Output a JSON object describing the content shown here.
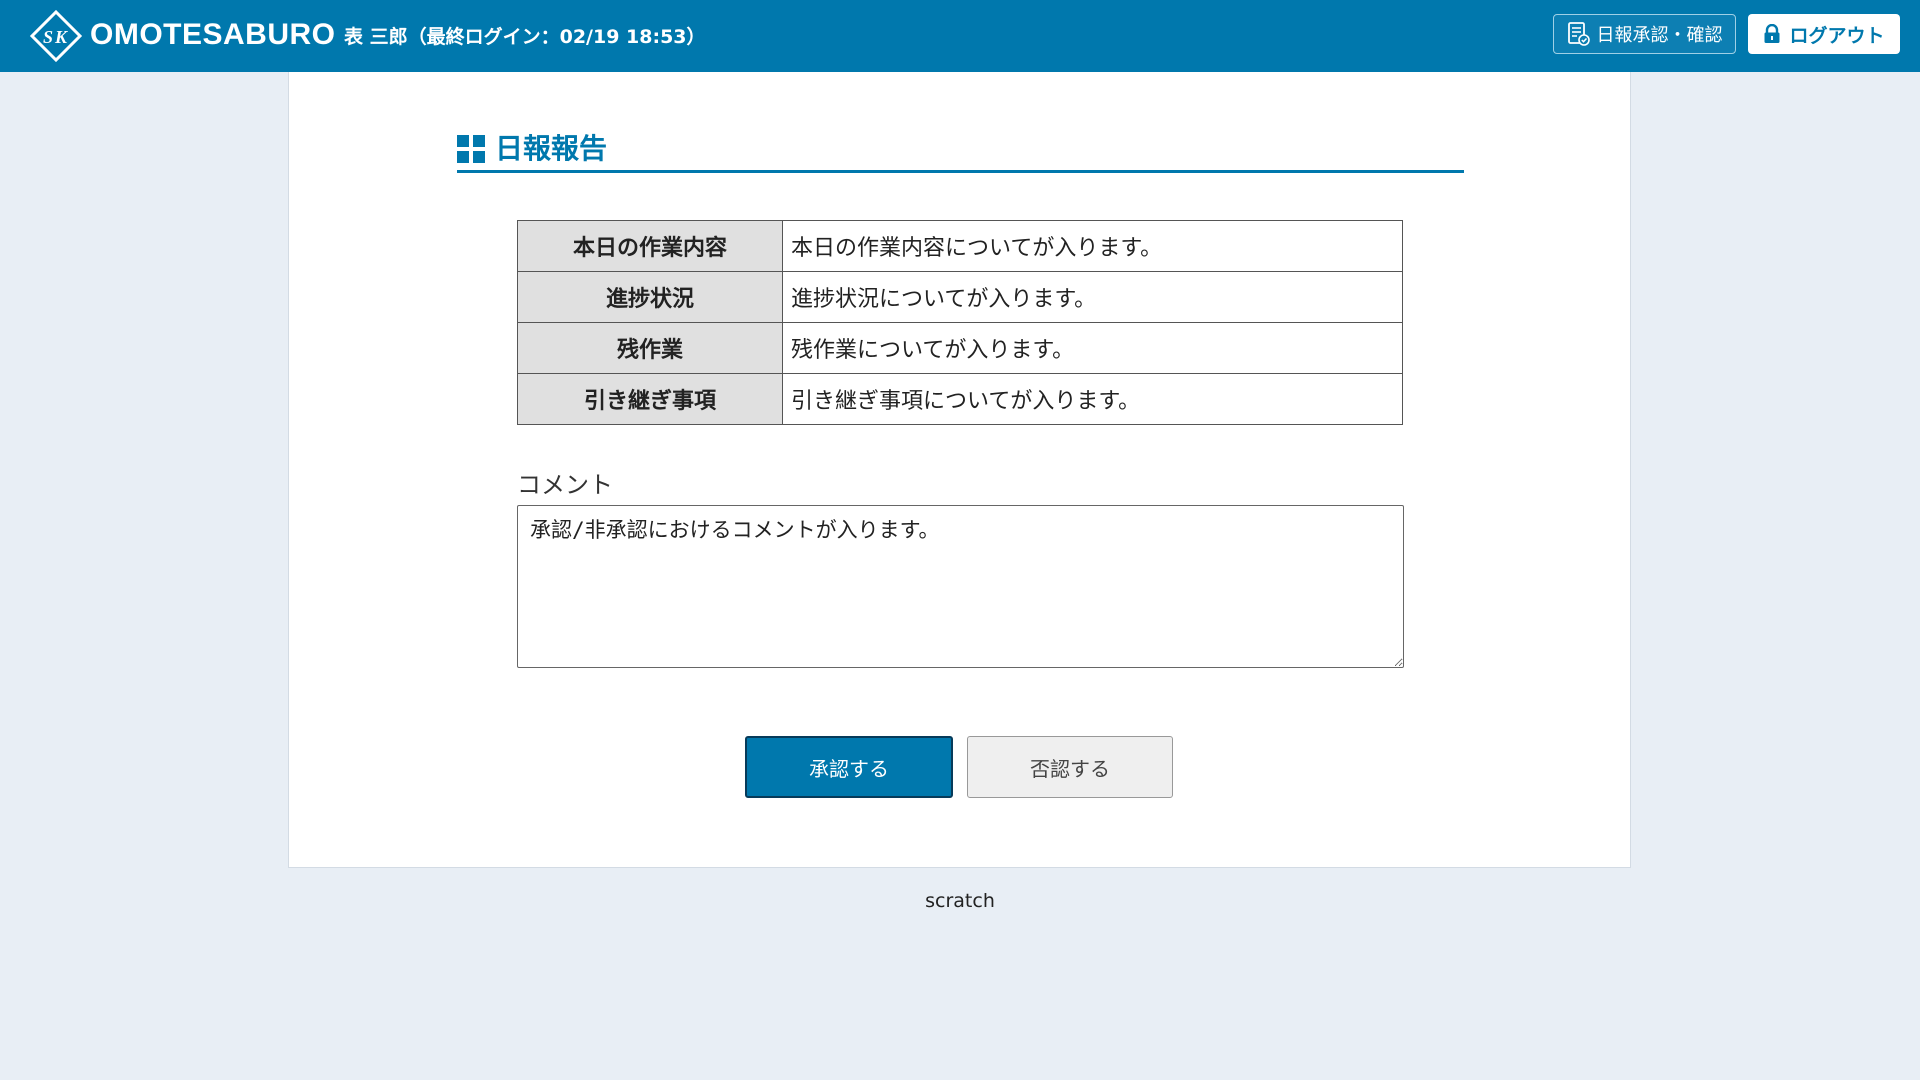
{
  "header": {
    "brand": "OMOTESABURO",
    "user_info": "表 三郎（最終ログイン：02/19 18:53）",
    "approve_nav_label": "日報承認・確認",
    "logout_label": "ログアウト",
    "background_color": "#0078ad"
  },
  "main": {
    "section_title": "日報報告",
    "report_rows": [
      {
        "label": "本日の作業内容",
        "value": "本日の作業内容についてが入ります。"
      },
      {
        "label": "進捗状況",
        "value": "進捗状況についてが入ります。"
      },
      {
        "label": "残作業",
        "value": "残作業についてが入ります。"
      },
      {
        "label": "引き継ぎ事項",
        "value": "引き継ぎ事項についてが入ります。"
      }
    ],
    "comment_label": "コメント",
    "comment_value": "承認/非承認におけるコメントが入ります。",
    "approve_button": "承認する",
    "reject_button": "否認する"
  },
  "footer": {
    "text": "scratch"
  },
  "icons": {
    "logo": "sk-diamond-logo-icon",
    "approve_nav": "document-check-icon",
    "logout": "lock-icon",
    "section": "grid-icon",
    "resize": "resize-grip-icon"
  }
}
